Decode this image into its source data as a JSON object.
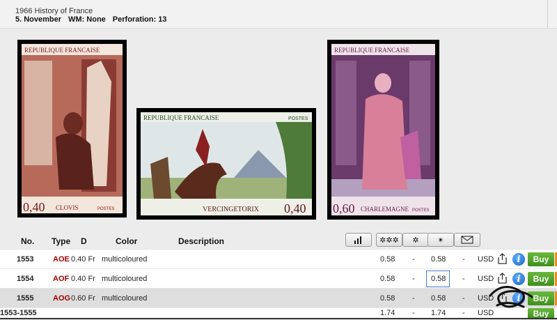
{
  "header": {
    "title": "1966 History of France",
    "issue_date": "5. November",
    "wm": "WM: None",
    "perforation": "Perforation: 13"
  },
  "stamps": [
    {
      "country": "REPUBLIQUE FRANCAISE",
      "value": "0,40",
      "name": "CLOVIS",
      "postes": "POSTES"
    },
    {
      "country": "REPUBLIQUE FRANCAISE",
      "value": "0,40",
      "name": "VERCINGETORIX",
      "postes": "POSTES"
    },
    {
      "country": "REPUBLIQUE FRANCAISE",
      "value": "0,60",
      "name": "CHARLEMAGNE",
      "postes": "POSTES"
    }
  ],
  "table": {
    "headers": {
      "no": "No.",
      "type": "Type",
      "d": "D",
      "color": "Color",
      "description": "Description"
    },
    "icon_buttons": [
      "bar-chart-icon",
      "stars-icon",
      "star-icon",
      "sun-icon",
      "envelope-icon"
    ],
    "rows": [
      {
        "no": "1553",
        "type": "AOE",
        "value": "0.40 Fr",
        "color": "multicoloured",
        "p1": "0.58",
        "d1": "-",
        "p2": "0.58",
        "d2": "-",
        "currency": "USD",
        "buy": "Buy"
      },
      {
        "no": "1554",
        "type": "AOF",
        "value": "0.40 Fr",
        "color": "multicoloured",
        "p1": "0.58",
        "d1": "-",
        "p2": "0.58",
        "d2": "-",
        "currency": "USD",
        "buy": "Buy"
      },
      {
        "no": "1555",
        "type": "AOG",
        "value": "0.60 Fr",
        "color": "multicoloured",
        "p1": "0.58",
        "d1": "-",
        "p2": "0.58",
        "d2": "-",
        "currency": "USD",
        "buy": "Buy"
      }
    ],
    "total": {
      "no": "1553-1555",
      "p1": "1.74",
      "d1": "-",
      "p2": "1.74",
      "d2": "-",
      "currency": "USD",
      "buy": "Buy"
    }
  },
  "colors": {
    "buy_green": "#4ea32a",
    "type_red": "#a30000",
    "accent_orange": "#e98a1a"
  }
}
